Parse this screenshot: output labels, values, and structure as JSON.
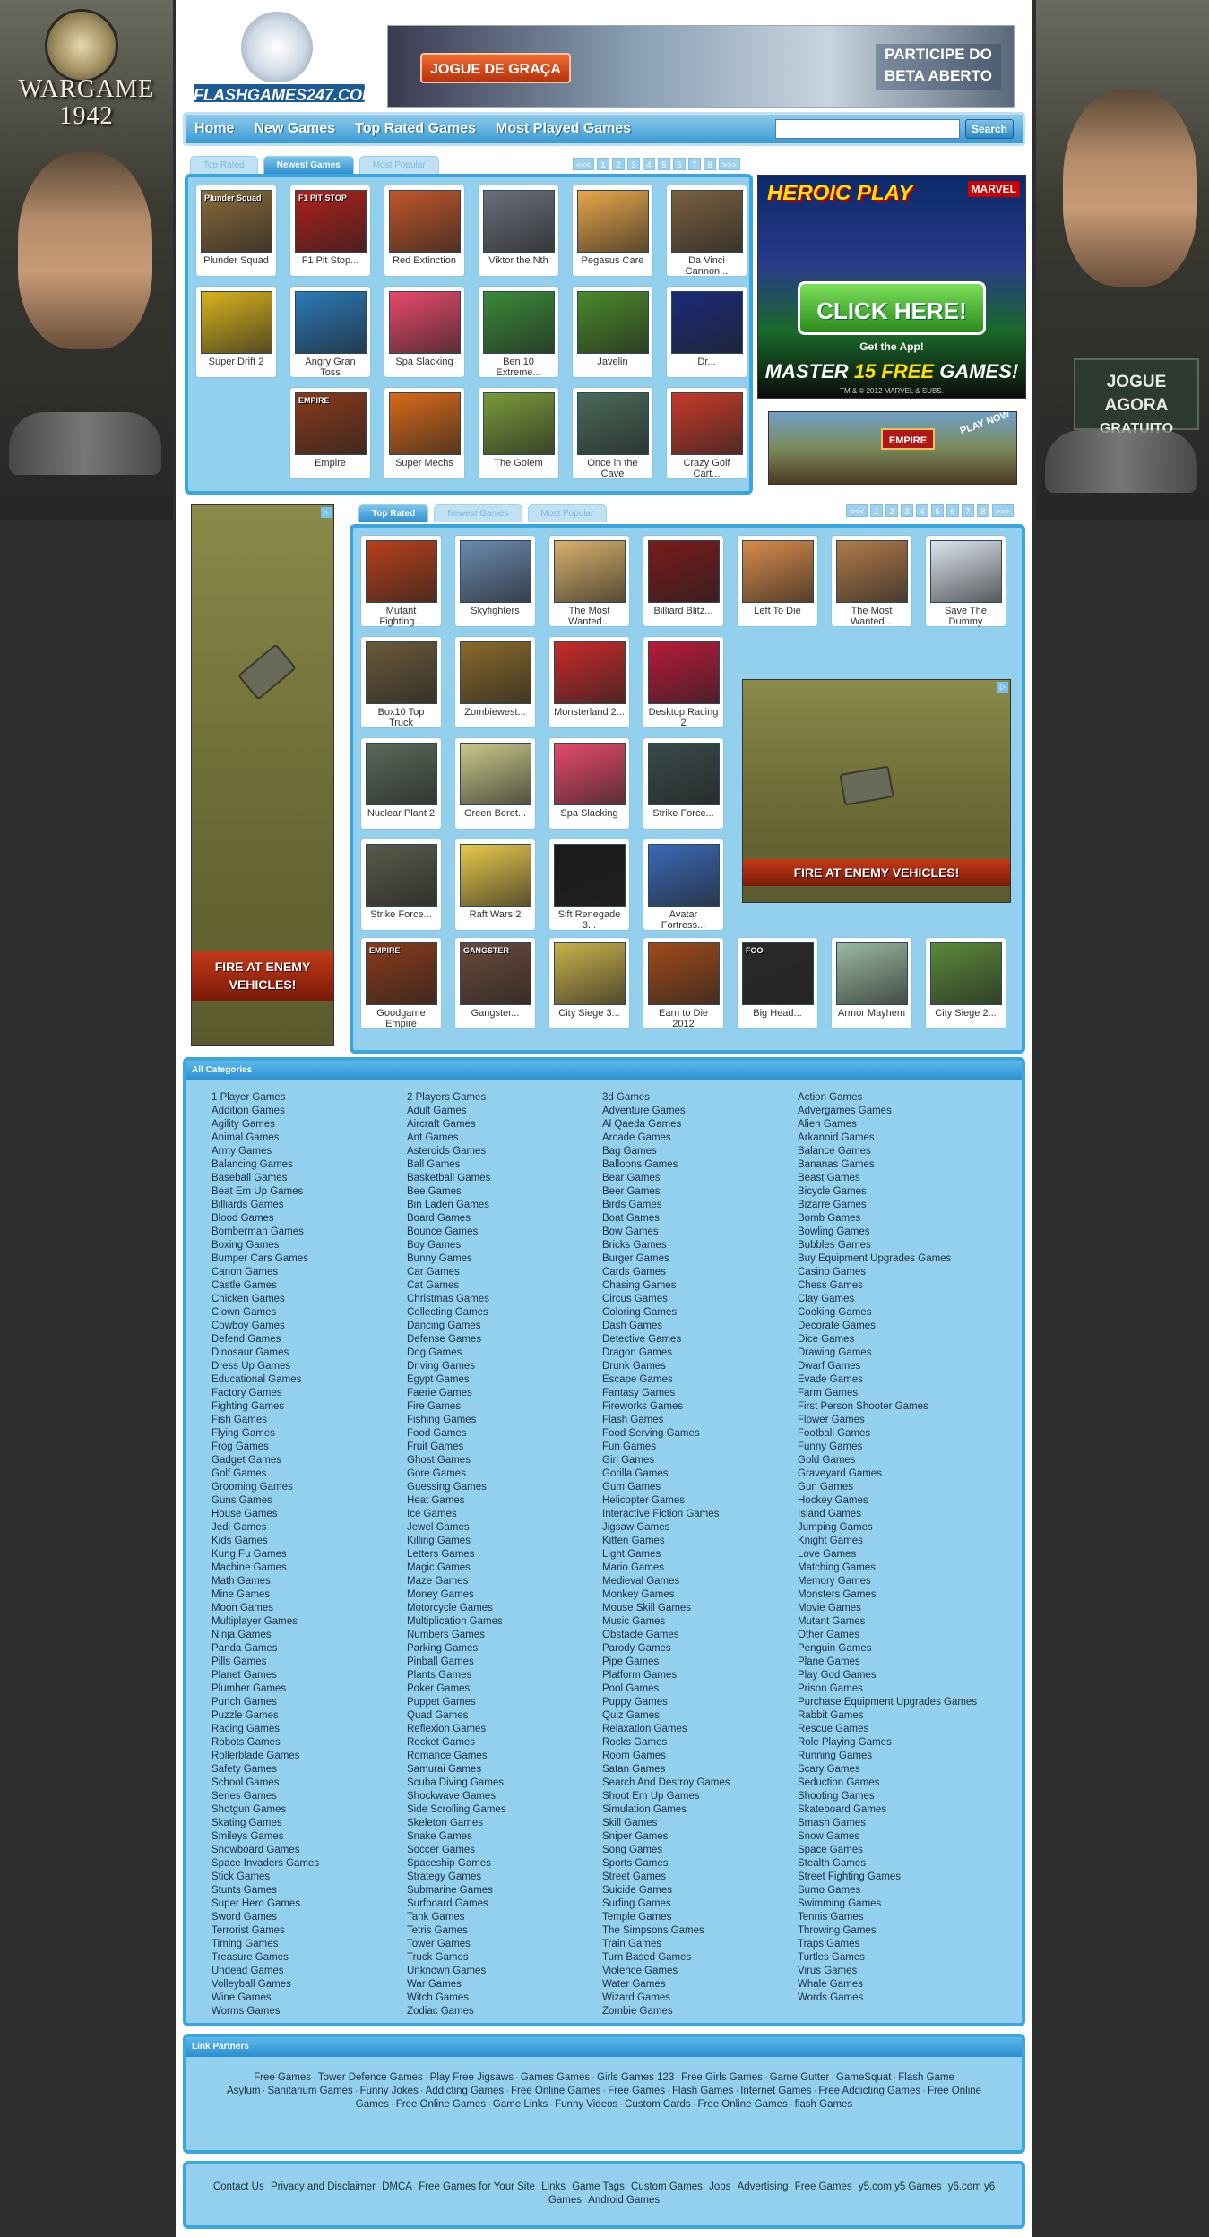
{
  "side_left": {
    "title_line1": "WARGAME",
    "title_line2": "1942"
  },
  "side_right": {
    "line1": "JOGUE AGORA",
    "line2": "GRATUITO"
  },
  "logo": {
    "text": "FLASHGAMES247.COM"
  },
  "top_banner": {
    "cta": "JOGUE DE GRAÇA",
    "tagline": "PARTICIPE DO BETA ABERTO"
  },
  "nav": {
    "items": [
      "Home",
      "New Games",
      "Top Rated Games",
      "Most Played Games"
    ],
    "search_placeholder": "",
    "search_button": "Search"
  },
  "top_section": {
    "tabs": [
      "Top Rated",
      "Newest Games",
      "Most Popular"
    ],
    "active_tab": 1,
    "pager": [
      "<<<",
      "1",
      "2",
      "3",
      "4",
      "5",
      "6",
      "7",
      "8",
      ">>>"
    ],
    "games": [
      {
        "title": "Plunder Squad",
        "thumb_label": "Plunder Squad",
        "color": "#8a6a3a"
      },
      {
        "title": "F1 Pit Stop...",
        "thumb_label": "F1 PIT STOP",
        "color": "#b0201a"
      },
      {
        "title": "Red Extinction",
        "thumb_label": "",
        "color": "#c2562a"
      },
      {
        "title": "Viktor the Nth",
        "thumb_label": "",
        "color": "#6a6f7a"
      },
      {
        "title": "Pegasus Care",
        "thumb_label": "",
        "color": "#e8a64a"
      },
      {
        "title": "Da Vinci Cannon...",
        "thumb_label": "",
        "color": "#7a6040"
      },
      {
        "title": "Super Drift 2",
        "thumb_label": "",
        "color": "#d8b21c"
      },
      {
        "title": "Angry Gran Toss",
        "thumb_label": "",
        "color": "#2a7ab8"
      },
      {
        "title": "Spa Slacking",
        "thumb_label": "",
        "color": "#e84a6a"
      },
      {
        "title": "Ben 10 Extreme...",
        "thumb_label": "",
        "color": "#3a8a3a"
      },
      {
        "title": "Javelin",
        "thumb_label": "",
        "color": "#4a8a2a"
      },
      {
        "title": "Dr...",
        "thumb_label": "",
        "color": "#1a2a7a"
      },
      {
        "title": "Empire",
        "thumb_label": "EMPIRE",
        "color": "#8a3a1a"
      },
      {
        "title": "Super Mechs",
        "thumb_label": "",
        "color": "#d86a1a"
      },
      {
        "title": "The Golem",
        "thumb_label": "",
        "color": "#7a9a3a"
      },
      {
        "title": "Once in the Cave",
        "thumb_label": "",
        "color": "#4a6a5a"
      },
      {
        "title": "Crazy Golf Cart...",
        "thumb_label": "",
        "color": "#c83a2a"
      }
    ]
  },
  "heroic_ad": {
    "title": "HEROIC PLAY",
    "brand": "MARVEL",
    "cta": "CLICK HERE!",
    "sub": "Get the App!",
    "master_pre": "MASTER",
    "master_num": "15 FREE",
    "master_post": "GAMES!",
    "legal": "TM & © 2012 MARVEL & SUBS."
  },
  "empire_ad": {
    "badge": "EMPIRE",
    "corner": "PLAY NOW"
  },
  "tank_ad_left": {
    "text_line1": "FIRE AT ENEMY",
    "text_line2": "VEHICLES!"
  },
  "tank_ad_right": {
    "text": "FIRE AT ENEMY VEHICLES!"
  },
  "main_section": {
    "tabs": [
      "Top Rated",
      "Newest Games",
      "Most Popular"
    ],
    "active_tab": 0,
    "pager": [
      "<<<",
      "1",
      "2",
      "3",
      "4",
      "5",
      "6",
      "7",
      "8",
      ">>>"
    ],
    "games_row1": [
      {
        "title": "Mutant Fighting...",
        "color": "#b8401a"
      },
      {
        "title": "Skyfighters",
        "color": "#6a8ab0"
      },
      {
        "title": "The Most Wanted...",
        "color": "#d8b06a"
      },
      {
        "title": "Billiard Blitz...",
        "color": "#7a1a1a"
      },
      {
        "title": "Left To Die",
        "color": "#d88a4a"
      },
      {
        "title": "The Most Wanted...",
        "color": "#b07a4a"
      },
      {
        "title": "Save The Dummy",
        "color": "#dde4ee"
      }
    ],
    "games_left": [
      {
        "title": "Box10 Top Truck",
        "color": "#6a5a3a"
      },
      {
        "title": "Zombiewest...",
        "color": "#8a6a2a"
      },
      {
        "title": "Monsterland 2...",
        "color": "#c82a2a"
      },
      {
        "title": "Desktop Racing 2",
        "color": "#b81a3a"
      },
      {
        "title": "Nuclear Plant 2",
        "color": "#5a6a5a"
      },
      {
        "title": "Green Beret...",
        "color": "#c8c88a"
      },
      {
        "title": "Spa Slacking",
        "color": "#e84a6a"
      },
      {
        "title": "Strike Force...",
        "color": "#3a4a4a"
      },
      {
        "title": "Strike Force...",
        "color": "#5a5a4a"
      },
      {
        "title": "Raft Wars 2",
        "color": "#e8c84a"
      },
      {
        "title": "Sift Renegade 3...",
        "color": "#1a1a1a"
      },
      {
        "title": "Avatar Fortress...",
        "color": "#3a6ab8"
      }
    ],
    "games_last": [
      {
        "title": "Goodgame Empire",
        "thumb_label": "EMPIRE",
        "color": "#8a3a1a"
      },
      {
        "title": "Gangster...",
        "thumb_label": "GANGSTER",
        "color": "#6a4a3a"
      },
      {
        "title": "City Siege 3...",
        "thumb_label": "",
        "color": "#c8b04a"
      },
      {
        "title": "Earn to Die 2012",
        "thumb_label": "",
        "color": "#a04a1a"
      },
      {
        "title": "Big Head...",
        "thumb_label": "FOO",
        "color": "#2a2a2a"
      },
      {
        "title": "Armor Mayhem",
        "thumb_label": "",
        "color": "#9ab8a0"
      },
      {
        "title": "City Siege 2...",
        "thumb_label": "",
        "color": "#5a8a3a"
      }
    ]
  },
  "categories": {
    "title": "All Categories",
    "col1": [
      "1 Player Games",
      "Addition Games",
      "Agility Games",
      "Animal Games",
      "Army Games",
      "Balancing Games",
      "Baseball Games",
      "Beat Em Up Games",
      "Billiards Games",
      "Blood Games",
      "Bomberman Games",
      "Boxing Games",
      "Bumper Cars Games",
      "Canon Games",
      "Castle Games",
      "Chicken Games",
      "Clown Games",
      "Cowboy Games",
      "Defend Games",
      "Dinosaur Games",
      "Dress Up Games",
      "Educational Games",
      "Factory Games",
      "Fighting Games",
      "Fish Games",
      "Flying Games",
      "Frog Games",
      "Gadget Games",
      "Golf Games",
      "Grooming Games",
      "Guns Games",
      "House Games",
      "Jedi Games",
      "Kids Games",
      "Kung Fu Games",
      "Machine Games",
      "Math Games",
      "Mine Games",
      "Moon Games",
      "Multiplayer Games",
      "Ninja Games",
      "Panda Games",
      "Pills Games",
      "Planet Games",
      "Plumber Games",
      "Punch Games",
      "Puzzle Games",
      "Racing Games",
      "Robots Games",
      "Rollerblade Games",
      "Safety Games",
      "School Games",
      "Series Games",
      "Shotgun Games",
      "Skating Games",
      "Smileys Games",
      "Snowboard Games",
      "Space Invaders Games",
      "Stick Games",
      "Stunts Games",
      "Super Hero Games",
      "Sword Games",
      "Terrorist Games",
      "Timing Games",
      "Treasure Games",
      "Undead Games",
      "Volleyball Games",
      "Wine Games",
      "Worms Games"
    ],
    "col2": [
      "2 Players Games",
      "Adult Games",
      "Aircraft Games",
      "Ant Games",
      "Asteroids Games",
      "Ball Games",
      "Basketball Games",
      "Bee Games",
      "Bin Laden Games",
      "Board Games",
      "Bounce Games",
      "Boy Games",
      "Bunny Games",
      "Car Games",
      "Cat Games",
      "Christmas Games",
      "Collecting Games",
      "Dancing Games",
      "Defense Games",
      "Dog Games",
      "Driving Games",
      "Egypt Games",
      "Faerie Games",
      "Fire Games",
      "Fishing Games",
      "Food Games",
      "Fruit Games",
      "Ghost Games",
      "Gore Games",
      "Guessing Games",
      "Heat Games",
      "Ice Games",
      "Jewel Games",
      "Killing Games",
      "Letters Games",
      "Magic Games",
      "Maze Games",
      "Money Games",
      "Motorcycle Games",
      "Multiplication Games",
      "Numbers Games",
      "Parking Games",
      "Pinball Games",
      "Plants Games",
      "Poker Games",
      "Puppet Games",
      "Quad Games",
      "Reflexion Games",
      "Rocket Games",
      "Romance Games",
      "Samurai Games",
      "Scuba Diving Games",
      "Shockwave Games",
      "Side Scrolling Games",
      "Skeleton Games",
      "Snake Games",
      "Soccer Games",
      "Spaceship Games",
      "Strategy Games",
      "Submarine Games",
      "Surfboard Games",
      "Tank Games",
      "Tetris Games",
      "Tower Games",
      "Truck Games",
      "Unknown Games",
      "War Games",
      "Witch Games",
      "Zodiac Games"
    ],
    "col3": [
      "3d Games",
      "Adventure Games",
      "Al Qaeda Games",
      "Arcade Games",
      "Bag Games",
      "Balloons Games",
      "Bear Games",
      "Beer Games",
      "Birds Games",
      "Boat Games",
      "Bow Games",
      "Bricks Games",
      "Burger Games",
      "Cards Games",
      "Chasing Games",
      "Circus Games",
      "Coloring Games",
      "Dash Games",
      "Detective Games",
      "Dragon Games",
      "Drunk Games",
      "Escape Games",
      "Fantasy Games",
      "Fireworks Games",
      "Flash Games",
      "Food Serving Games",
      "Fun Games",
      "Girl Games",
      "Gorilla Games",
      "Gum Games",
      "Helicopter Games",
      "Interactive Fiction Games",
      "Jigsaw Games",
      "Kitten Games",
      "Light Games",
      "Mario Games",
      "Medieval Games",
      "Monkey Games",
      "Mouse Skill Games",
      "Music Games",
      "Obstacle Games",
      "Parody Games",
      "Pipe Games",
      "Platform Games",
      "Pool Games",
      "Puppy Games",
      "Quiz Games",
      "Relaxation Games",
      "Rocks Games",
      "Room Games",
      "Satan Games",
      "Search And Destroy Games",
      "Shoot Em Up Games",
      "Simulation Games",
      "Skill Games",
      "Sniper Games",
      "Song Games",
      "Sports Games",
      "Street Games",
      "Suicide Games",
      "Surfing Games",
      "Temple Games",
      "The Simpsons Games",
      "Train Games",
      "Turn Based Games",
      "Violence Games",
      "Water Games",
      "Wizard Games",
      "Zombie Games"
    ],
    "col4": [
      "Action Games",
      "Advergames Games",
      "Alien Games",
      "Arkanoid Games",
      "Balance Games",
      "Bananas Games",
      "Beast Games",
      "Bicycle Games",
      "Bizarre Games",
      "Bomb Games",
      "Bowling Games",
      "Bubbles Games",
      "Buy Equipment Upgrades Games",
      "Casino Games",
      "Chess Games",
      "Clay Games",
      "Cooking Games",
      "Decorate Games",
      "Dice Games",
      "Drawing Games",
      "Dwarf Games",
      "Evade Games",
      "Farm Games",
      "First Person Shooter Games",
      "Flower Games",
      "Football Games",
      "Funny Games",
      "Gold Games",
      "Graveyard Games",
      "Gun Games",
      "Hockey Games",
      "Island Games",
      "Jumping Games",
      "Knight Games",
      "Love Games",
      "Matching Games",
      "Memory Games",
      "Monsters Games",
      "Movie Games",
      "Mutant Games",
      "Other Games",
      "Penguin Games",
      "Plane Games",
      "Play God Games",
      "Prison Games",
      "Purchase Equipment Upgrades Games",
      "Rabbit Games",
      "Rescue Games",
      "Role Playing Games",
      "Running Games",
      "Scary Games",
      "Seduction Games",
      "Shooting Games",
      "Skateboard Games",
      "Smash Games",
      "Snow Games",
      "Space Games",
      "Stealth Games",
      "Street Fighting Games",
      "Sumo Games",
      "Swimming Games",
      "Tennis Games",
      "Throwing Games",
      "Traps Games",
      "Turtles Games",
      "Virus Games",
      "Whale Games",
      "Words Games"
    ]
  },
  "link_partners": {
    "title": "Link Partners",
    "links": [
      "Free Games",
      "Tower Defence Games",
      "Play Free Jigsaws",
      "Games Games",
      "Girls Games 123",
      "Free Girls Games",
      "Game Gutter",
      "GameSquat",
      "Flash Game Asylum",
      "Sanitarium Games",
      "Funny Jokes",
      "Addicting Games",
      "Free Online Games",
      "Free Games",
      "Flash Games",
      "Internet Games",
      "Free Addicting Games",
      "Free Online Games",
      "Free Online Games",
      "Game Links",
      "Funny Videos",
      "Custom Cards",
      "Free Online Games",
      "flash Games"
    ]
  },
  "footer": {
    "links": [
      "Contact Us",
      "Privacy and Disclaimer",
      "DMCA",
      "Free Games for Your Site",
      "Links",
      "Game Tags",
      "Custom Games",
      "Jobs",
      "Advertising",
      "Free Games",
      "y5.com y5 Games",
      "y6.com y6 Games",
      "Android Games"
    ]
  }
}
